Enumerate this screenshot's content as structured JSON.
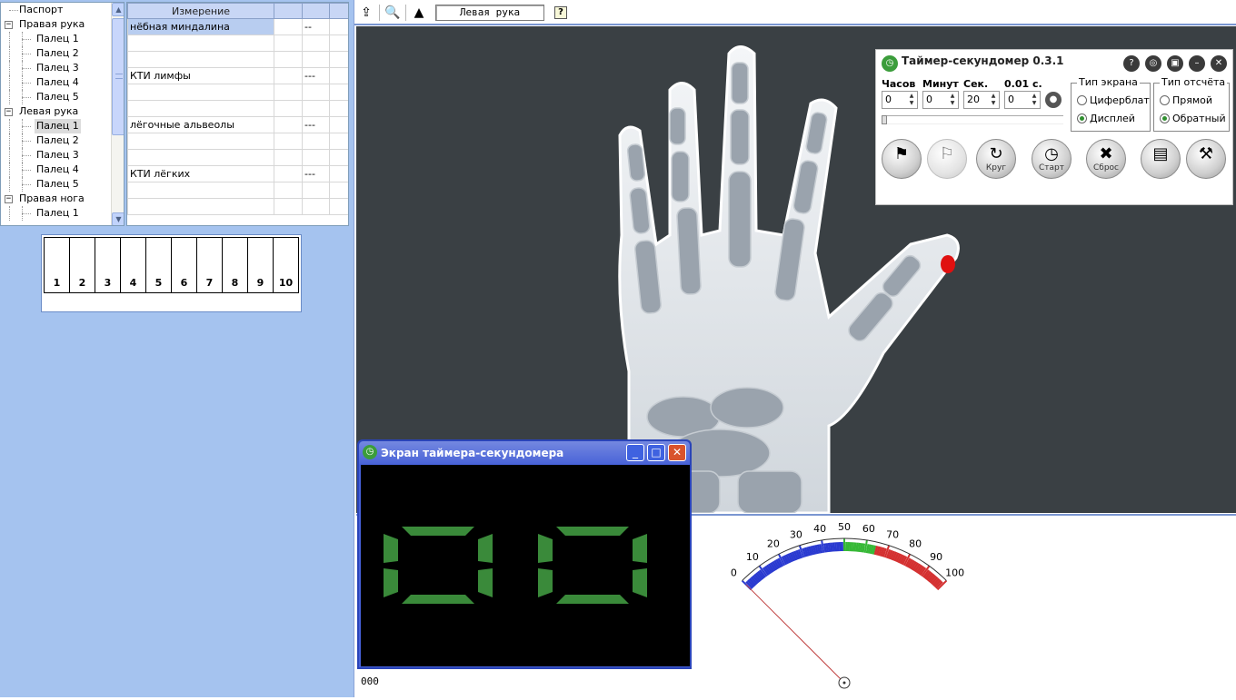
{
  "tree": {
    "items": [
      {
        "label": "Паспорт",
        "level": 0,
        "expander": ""
      },
      {
        "label": "Правая рука",
        "level": 0,
        "expander": "−"
      },
      {
        "label": "Палец 1",
        "level": 1,
        "expander": ""
      },
      {
        "label": "Палец 2",
        "level": 1,
        "expander": ""
      },
      {
        "label": "Палец 3",
        "level": 1,
        "expander": ""
      },
      {
        "label": "Палец 4",
        "level": 1,
        "expander": ""
      },
      {
        "label": "Палец 5",
        "level": 1,
        "expander": ""
      },
      {
        "label": "Левая рука",
        "level": 0,
        "expander": "−"
      },
      {
        "label": "Палец 1",
        "level": 1,
        "expander": "",
        "selected": true
      },
      {
        "label": "Палец 2",
        "level": 1,
        "expander": ""
      },
      {
        "label": "Палец 3",
        "level": 1,
        "expander": ""
      },
      {
        "label": "Палец 4",
        "level": 1,
        "expander": ""
      },
      {
        "label": "Палец 5",
        "level": 1,
        "expander": ""
      },
      {
        "label": "Правая нога",
        "level": 0,
        "expander": "−"
      },
      {
        "label": "Палец 1",
        "level": 1,
        "expander": ""
      }
    ],
    "scroll_up": "▲",
    "scroll_down": "▼"
  },
  "grid": {
    "headers": [
      "Измерение",
      "",
      ""
    ],
    "rows": [
      [
        "нёбная миндалина",
        "",
        "--"
      ],
      [
        "",
        "",
        ""
      ],
      [
        "",
        "",
        ""
      ],
      [
        "КТИ лимфы",
        "",
        "---"
      ],
      [
        "",
        "",
        ""
      ],
      [
        "",
        "",
        ""
      ],
      [
        "лёгочные альвеолы",
        "",
        "---"
      ],
      [
        "",
        "",
        ""
      ],
      [
        "",
        "",
        ""
      ],
      [
        "КТИ лёгких",
        "",
        "---"
      ],
      [
        "",
        "",
        ""
      ],
      [
        "",
        "",
        ""
      ]
    ]
  },
  "scale": {
    "cells": [
      "1",
      "2",
      "3",
      "4",
      "5",
      "6",
      "7",
      "8",
      "9",
      "10"
    ]
  },
  "toolbar": {
    "selected_view": "Левая рука",
    "help": "?"
  },
  "timer": {
    "title": "Таймер-секундомер 0.3.1",
    "hours_label": "Часов",
    "minutes_label": "Минут",
    "seconds_label": "Сек.",
    "centis_label": "0.01 с.",
    "hours": "0",
    "minutes": "0",
    "seconds": "20",
    "centis": "0",
    "screen_type_label": "Тип экрана",
    "screen_opt1": "Циферблат",
    "screen_opt2": "Дисплей",
    "count_type_label": "Тип отсчёта",
    "count_opt1": "Прямой",
    "count_opt2": "Обратный",
    "btn_lap": "Круг",
    "btn_start": "Старт",
    "btn_reset": "Сброс",
    "tb_help": "?",
    "accent": "#2f8f2f"
  },
  "display_window": {
    "title": "Экран таймера-секундомера",
    "digits": "00",
    "segment_color": "#3a8a3a"
  },
  "gauge": {
    "min": 0,
    "max": 100,
    "ticks": [
      "0",
      "10",
      "20",
      "30",
      "40",
      "50",
      "60",
      "70",
      "80",
      "90",
      "100"
    ],
    "value": 0,
    "zones": {
      "blue": "#2a3ad0",
      "green": "#36b836",
      "red": "#d43030"
    }
  },
  "status_readout": "000",
  "marker_color": "#e01010"
}
